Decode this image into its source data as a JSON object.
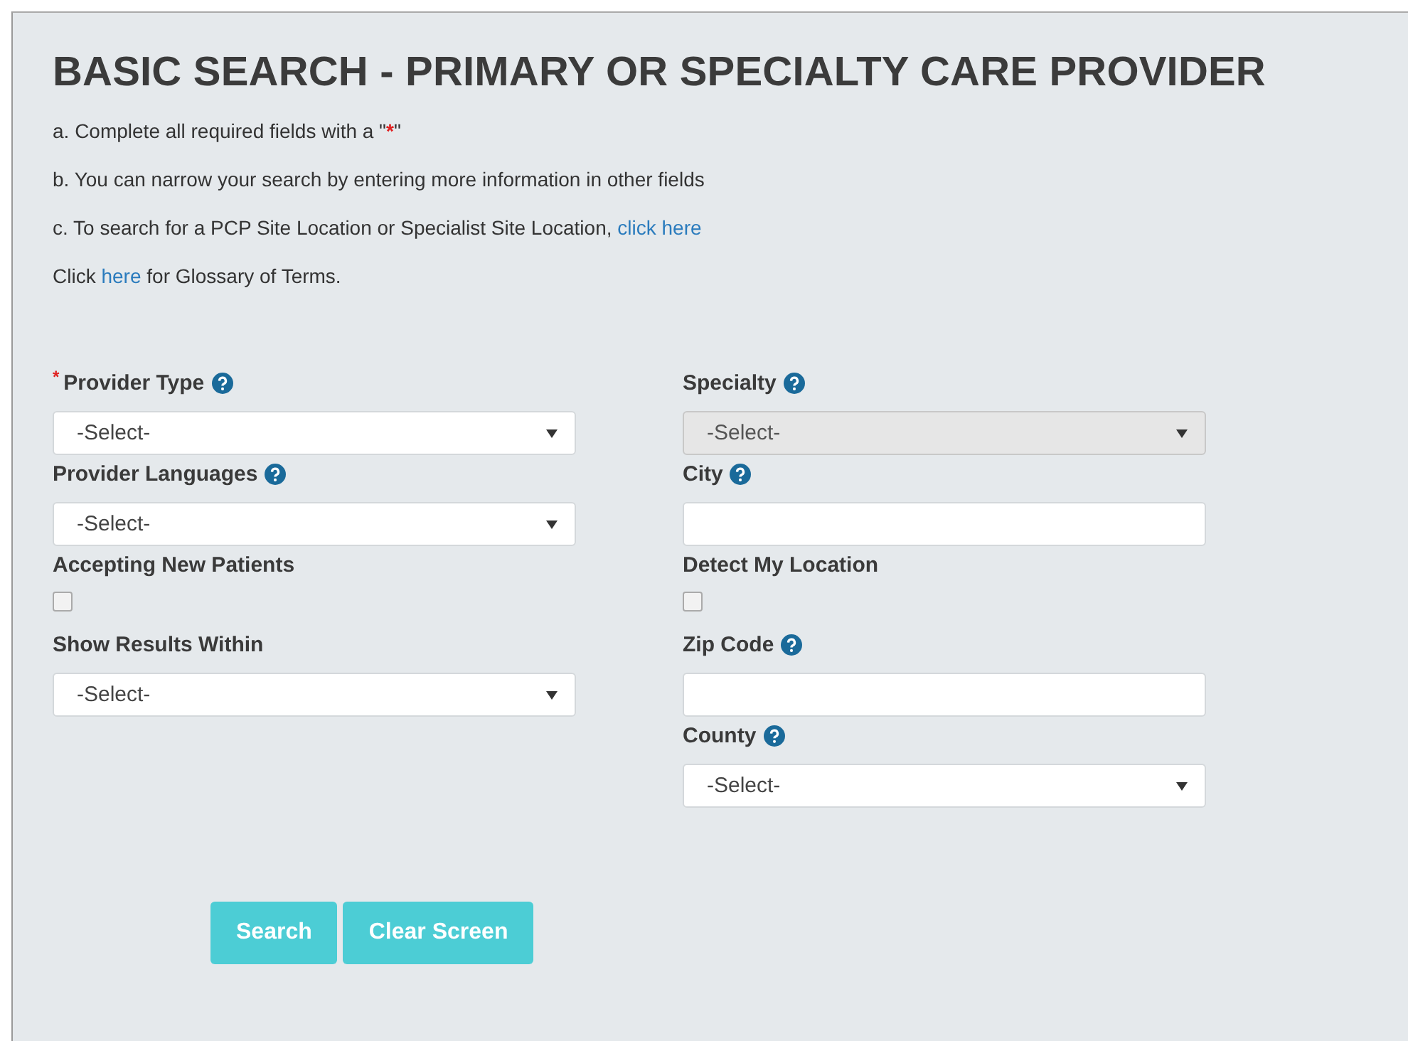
{
  "title": "BASIC SEARCH - PRIMARY OR SPECIALTY CARE PROVIDER",
  "instructions": [
    [
      {
        "kind": "text",
        "text": "a. Complete all required fields with a \""
      },
      {
        "kind": "required",
        "text": "*"
      },
      {
        "kind": "text",
        "text": "\""
      }
    ],
    [
      {
        "kind": "text",
        "text": "b. You can narrow your search by entering more information in other fields"
      }
    ],
    [
      {
        "kind": "text",
        "text": "c. To search for a PCP Site Location or Specialist Site Location, "
      },
      {
        "kind": "link",
        "text": "click here"
      }
    ],
    [
      {
        "kind": "text",
        "text": "Click "
      },
      {
        "kind": "link",
        "text": "here"
      },
      {
        "kind": "text",
        "text": " for Glossary of Terms."
      }
    ]
  ],
  "columns": [
    [
      {
        "kind": "select",
        "label": "Provider Type",
        "required_mark": "*",
        "help": true,
        "value": "-Select-",
        "disabled": false
      },
      {
        "kind": "select",
        "label": "Provider Languages",
        "help": true,
        "value": "-Select-",
        "disabled": false
      },
      {
        "kind": "checkbox",
        "label": "Accepting New Patients",
        "help": false,
        "checked": false
      },
      {
        "kind": "select",
        "label": "Show Results Within",
        "help": false,
        "value": "-Select-",
        "disabled": false
      }
    ],
    [
      {
        "kind": "select",
        "label": "Specialty",
        "help": true,
        "value": "-Select-",
        "disabled": true
      },
      {
        "kind": "text",
        "label": "City",
        "help": true
      },
      {
        "kind": "checkbox",
        "label": "Detect My Location",
        "help": false,
        "checked": false
      },
      {
        "kind": "text",
        "label": "Zip Code",
        "help": true
      },
      {
        "kind": "select",
        "label": "County",
        "help": true,
        "value": "-Select-",
        "disabled": false
      }
    ]
  ],
  "buttons": [
    "Search",
    "Clear Screen"
  ]
}
